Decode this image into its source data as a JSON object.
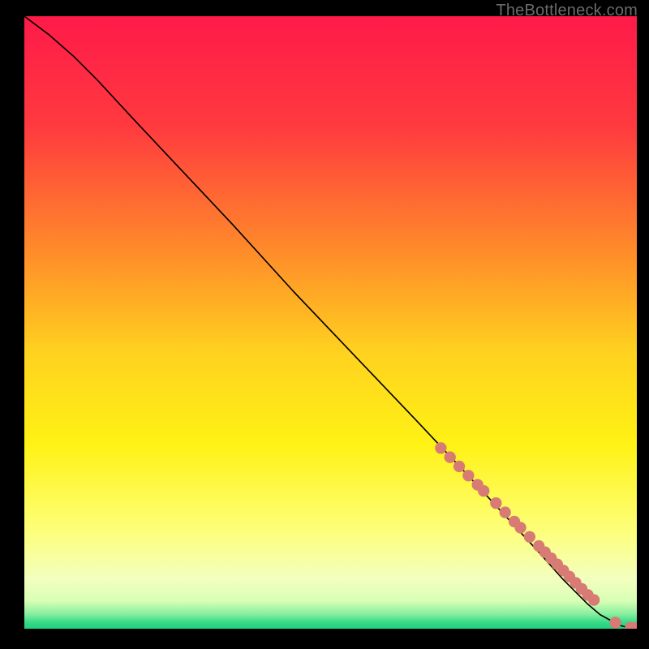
{
  "watermark": "TheBottleneck.com",
  "colors": {
    "gradient_stops": [
      {
        "pos": 0.0,
        "hex": "#ff1a49"
      },
      {
        "pos": 0.18,
        "hex": "#ff3a3f"
      },
      {
        "pos": 0.38,
        "hex": "#ff8a2a"
      },
      {
        "pos": 0.55,
        "hex": "#ffd21f"
      },
      {
        "pos": 0.7,
        "hex": "#fff215"
      },
      {
        "pos": 0.84,
        "hex": "#fdff7a"
      },
      {
        "pos": 0.92,
        "hex": "#f2ffbf"
      },
      {
        "pos": 0.955,
        "hex": "#d8ffb5"
      },
      {
        "pos": 0.975,
        "hex": "#8cf0a0"
      },
      {
        "pos": 0.99,
        "hex": "#36db86"
      },
      {
        "pos": 1.0,
        "hex": "#1fd07e"
      }
    ],
    "curve": "#000000",
    "marker": "#d77b74",
    "background": "#000000"
  },
  "chart_data": {
    "type": "line",
    "title": "",
    "xlabel": "",
    "ylabel": "",
    "xlim": [
      0,
      100
    ],
    "ylim": [
      0,
      100
    ],
    "series": [
      {
        "name": "curve",
        "x": [
          0,
          4,
          8,
          12,
          18,
          26,
          34,
          44,
          54,
          64,
          72,
          78,
          84,
          88,
          92,
          94,
          96,
          97,
          98.5,
          100
        ],
        "y": [
          100,
          97,
          93.5,
          89.5,
          83,
          74.5,
          66,
          55,
          44.5,
          34,
          25.5,
          19,
          12.5,
          8,
          4,
          2.3,
          1.2,
          0.6,
          0.2,
          0.15
        ]
      }
    ],
    "markers": {
      "name": "highlighted-points",
      "x": [
        68,
        69.5,
        71,
        72.5,
        74,
        75,
        77,
        78.5,
        80,
        81,
        82.5,
        84,
        85,
        86,
        87,
        88,
        89,
        90,
        91,
        92,
        93,
        96.5,
        99,
        100
      ],
      "y": [
        29.5,
        28,
        26.5,
        25,
        23.5,
        22.5,
        20.5,
        19,
        17.5,
        16.5,
        15,
        13.5,
        12.5,
        11.5,
        10.5,
        9.5,
        8.5,
        7.5,
        6.5,
        5.5,
        4.7,
        1.0,
        0.2,
        0.15
      ]
    }
  }
}
